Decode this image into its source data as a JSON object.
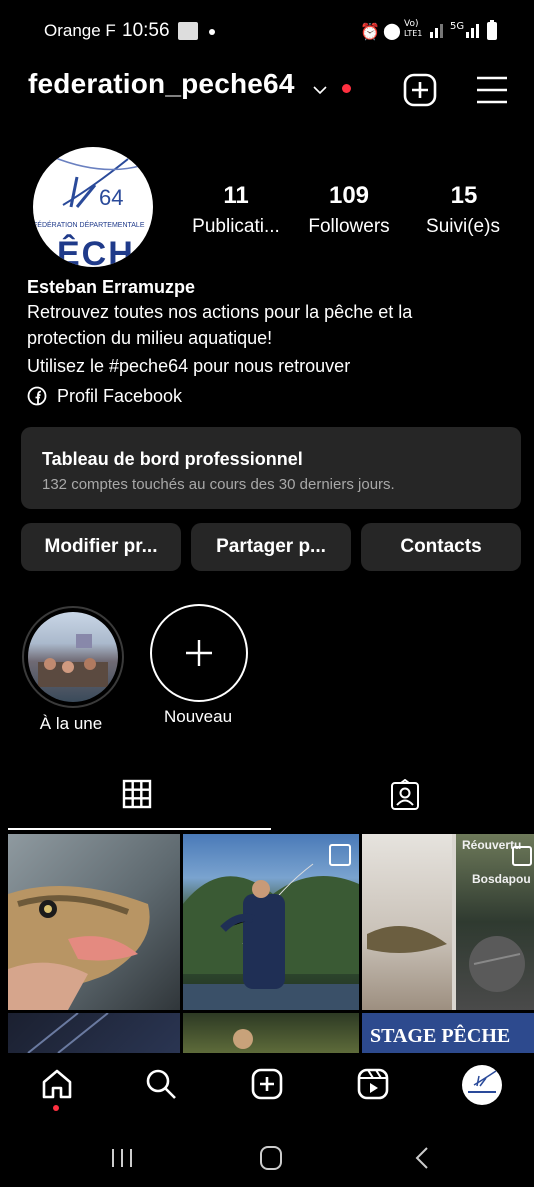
{
  "status_bar": {
    "carrier": "Orange F",
    "time": "10:56",
    "network_label_1": "Vo)",
    "network_label_2": "LTE1",
    "network_label_3": "5G"
  },
  "header": {
    "username": "federation_peche64"
  },
  "profile": {
    "avatar_text": "64",
    "avatar_caption": "FÉDÉRATION DÉPARTEMENTALE",
    "avatar_big": "ÊCH",
    "stats": [
      {
        "value": "11",
        "label": "Publicati..."
      },
      {
        "value": "109",
        "label": "Followers"
      },
      {
        "value": "15",
        "label": "Suivi(e)s"
      }
    ],
    "name": "Esteban Erramuzpe",
    "bio_line_1": "Retrouvez toutes nos actions pour la pêche et la",
    "bio_line_2": "protection du milieu aquatique!",
    "bio_line_3": "Utilisez le #peche64 pour nous retrouver",
    "facebook_link": "Profil Facebook"
  },
  "dashboard": {
    "title": "Tableau de bord professionnel",
    "subtitle": "132 comptes touchés au cours des 30 derniers jours."
  },
  "actions": {
    "edit": "Modifier pr...",
    "share": "Partager p...",
    "contacts": "Contacts"
  },
  "highlights": [
    {
      "label": "À la une"
    },
    {
      "label": "Nouveau"
    }
  ],
  "grid_overlays": {
    "tile3_text_1": "Réouvertu",
    "tile3_text_2": "Bosdapou",
    "tile6_text": "STAGE PÊCHE"
  },
  "colors": {
    "background": "#000000",
    "surface": "#262626",
    "notification": "#ff3040",
    "text": "#ffffff",
    "muted": "#a8a8a8"
  }
}
